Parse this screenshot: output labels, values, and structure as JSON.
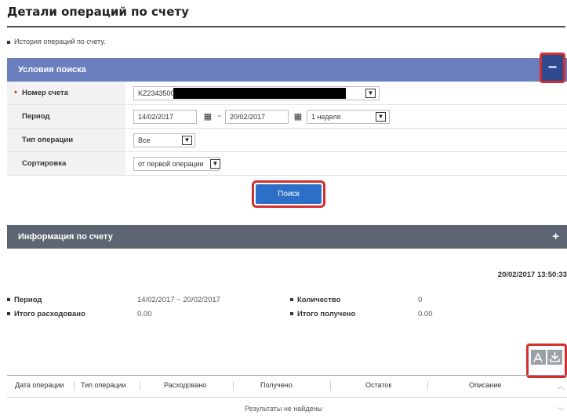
{
  "page": {
    "title": "Детали операций по счету",
    "intro": "История операций по счету."
  },
  "search_panel": {
    "title": "Условия поиска",
    "toggle_symbol": "–",
    "fields": {
      "account": {
        "label": "Номер счета",
        "value": "KZ2343500"
      },
      "period": {
        "label": "Период",
        "from": "14/02/2017",
        "separator": "~",
        "to": "20/02/2017",
        "preset": "1 неделя"
      },
      "operation_type": {
        "label": "Тип операции",
        "value": "Все"
      },
      "sort": {
        "label": "Сортировка",
        "value": "от первой операции"
      }
    },
    "search_button": "Поиск"
  },
  "info_panel": {
    "title": "Информация по счету",
    "toggle_symbol": "+",
    "timestamp": "20/02/2017 13:50:33",
    "summary": {
      "period_label": "Период",
      "period_value": "14/02/2017 ~ 20/02/2017",
      "count_label": "Количество",
      "count_value": "0",
      "spent_label": "Итого расходовано",
      "spent_value": "0.00",
      "received_label": "Итого получено",
      "received_value": "0.00"
    }
  },
  "table": {
    "columns": [
      "Дата операции",
      "Тип операции",
      "Расходовано",
      "Получено",
      "Остаток",
      "Описание"
    ],
    "empty_text": "Результаты не найдены"
  },
  "icons": {
    "pdf": "pdf-icon",
    "download": "download-icon",
    "calendar": "calendar-icon"
  },
  "colors": {
    "search_header": "#6b7fbf",
    "info_header": "#5d6572",
    "search_button": "#2d6fc7",
    "highlight": "#d32f2f"
  }
}
